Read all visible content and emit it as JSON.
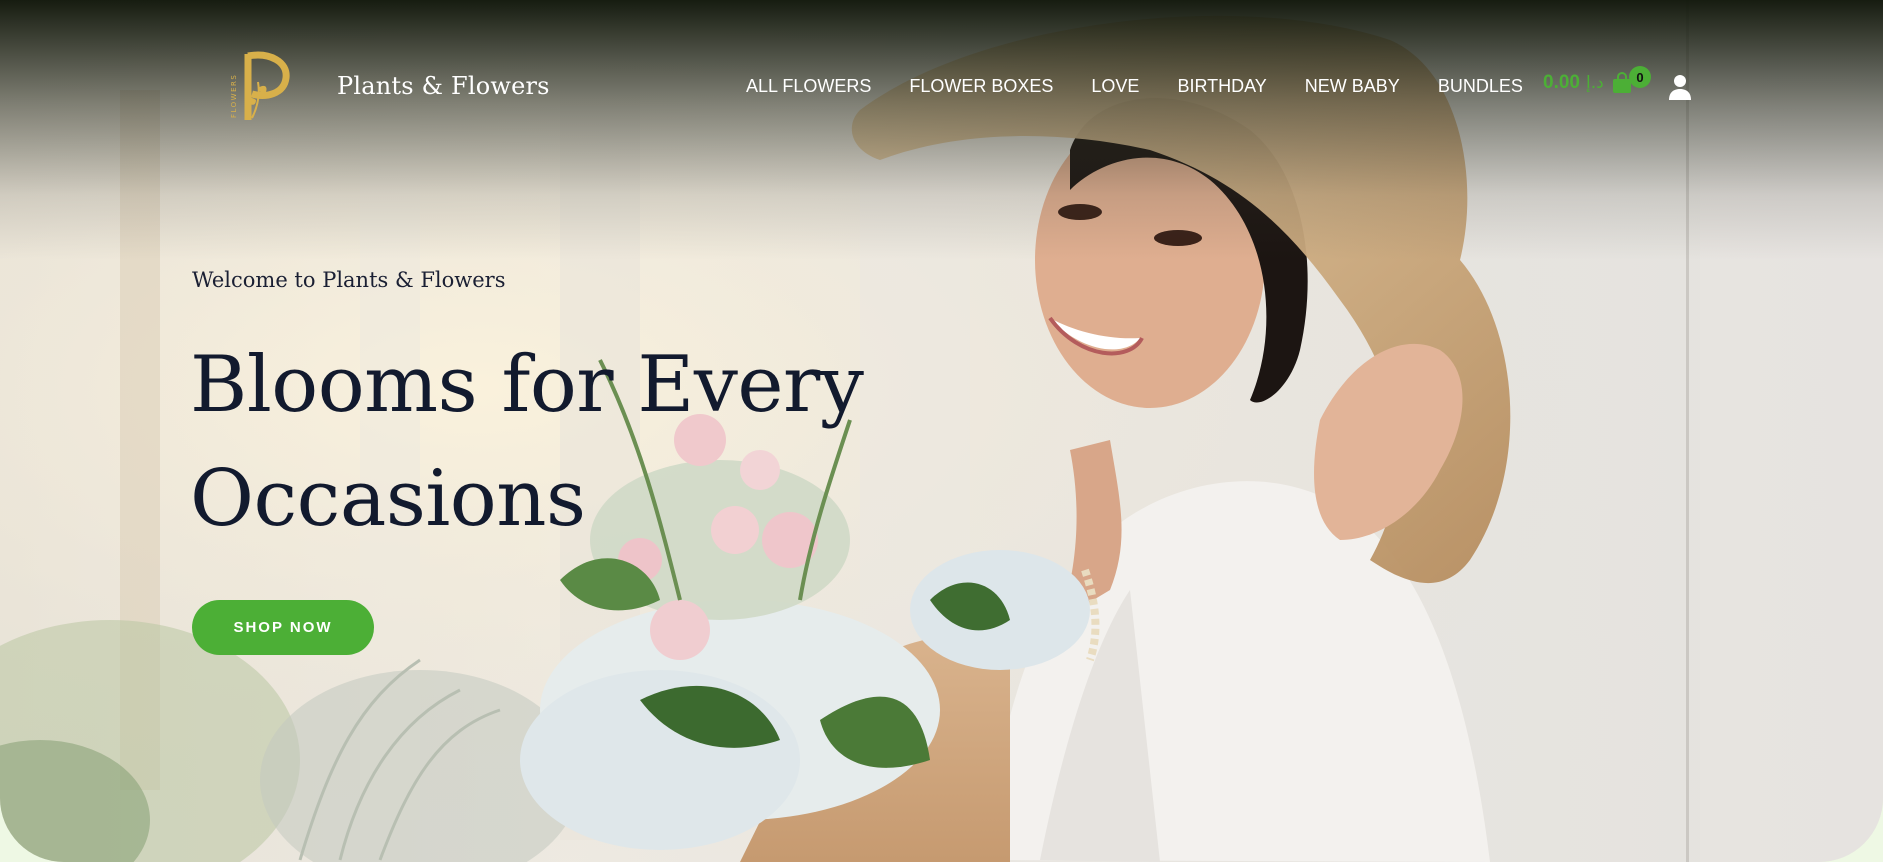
{
  "brand": {
    "name": "Plants & Flowers",
    "logo_letter": "P",
    "logo_text": "FLOWERS"
  },
  "nav": {
    "items": [
      {
        "label": "ALL FLOWERS"
      },
      {
        "label": "FLOWER BOXES"
      },
      {
        "label": "LOVE"
      },
      {
        "label": "BIRTHDAY"
      },
      {
        "label": "NEW BABY"
      },
      {
        "label": "BUNDLES"
      }
    ]
  },
  "cart": {
    "amount": "0.00",
    "currency": "د.إ",
    "count": "0",
    "icon": "shopping-bag-icon"
  },
  "account": {
    "icon": "user-icon"
  },
  "hero": {
    "welcome": "Welcome to Plants & Flowers",
    "headline_line1": "Blooms for Every",
    "headline_line2": "Occasions",
    "cta_label": "SHOP NOW"
  },
  "colors": {
    "accent": "#4caf36",
    "heading": "#121a2e",
    "logo_gold": "#d8b04a"
  }
}
